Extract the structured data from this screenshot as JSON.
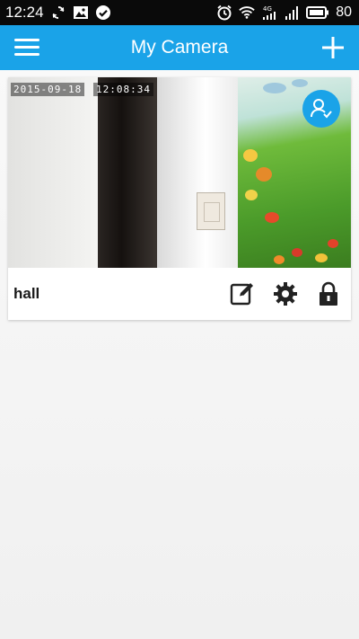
{
  "status_bar": {
    "time": "12:24",
    "battery": "80",
    "icons_left": [
      "sync-icon",
      "image-icon",
      "check-circle-icon"
    ],
    "icons_right": [
      "alarm-icon",
      "wifi-icon",
      "signal-4g-icon",
      "signal-icon",
      "battery-icon"
    ]
  },
  "app_bar": {
    "title": "My Camera",
    "menu_icon": "hamburger-menu-icon",
    "add_icon": "plus-icon",
    "color": "#1aa3e8"
  },
  "camera_card": {
    "name": "hall",
    "osd_date": "2015-09-18",
    "osd_time": "12:08:34",
    "badge_icon": "user-check-icon",
    "actions": [
      "edit-icon",
      "settings-gear-icon",
      "lock-icon"
    ]
  }
}
